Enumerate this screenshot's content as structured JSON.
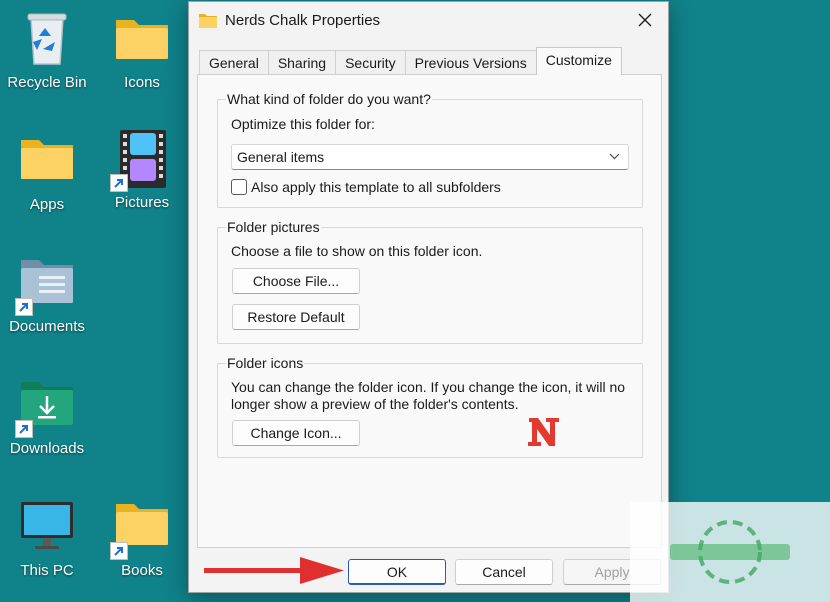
{
  "desktop": {
    "icons": [
      {
        "label": "Recycle Bin"
      },
      {
        "label": "Icons"
      },
      {
        "label": "Apps"
      },
      {
        "label": "Pictures"
      },
      {
        "label": "Documents"
      },
      {
        "label": "Downloads"
      },
      {
        "label": "This PC"
      },
      {
        "label": "Books"
      }
    ]
  },
  "dialog": {
    "title": "Nerds Chalk Properties",
    "tabs": [
      {
        "label": "General"
      },
      {
        "label": "Sharing"
      },
      {
        "label": "Security"
      },
      {
        "label": "Previous Versions"
      },
      {
        "label": "Customize",
        "active": true
      }
    ],
    "folder_type": {
      "heading": "What kind of folder do you want?",
      "optimize_label": "Optimize this folder for:",
      "selected_option": "General items",
      "subfolders_checkbox_label": "Also apply this template to all subfolders",
      "subfolders_checked": false
    },
    "folder_pictures": {
      "heading": "Folder pictures",
      "description": "Choose a file to show on this folder icon.",
      "choose_file_button": "Choose File...",
      "restore_default_button": "Restore Default"
    },
    "folder_icons": {
      "heading": "Folder icons",
      "description_line1": "You can change the folder icon. If you change the icon, it will no",
      "description_line2": "longer show a preview of the folder's contents.",
      "change_icon_button": "Change Icon..."
    },
    "buttons": {
      "ok": "OK",
      "cancel": "Cancel",
      "apply": "Apply"
    }
  },
  "colors": {
    "desktop_background": "#10828a",
    "accent_red": "#e23a2e",
    "primary_border": "#2a5caa"
  }
}
